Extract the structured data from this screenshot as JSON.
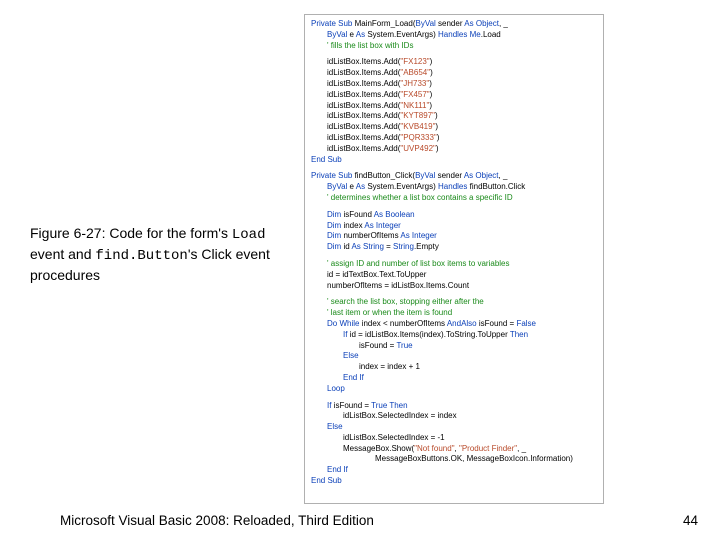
{
  "caption": {
    "prefix": "Figure 6-27: Code for the form's ",
    "mono1": "Load",
    "mid1": " event and ",
    "mono2": "find.Button",
    "mid2": "'s Click event procedures"
  },
  "footer": {
    "left": "Microsoft Visual Basic 2008: Reloaded, Third Edition",
    "page": "44"
  },
  "code": {
    "l01a": "Private Sub",
    "l01b": " MainForm_Load(",
    "l01c": "ByVal",
    "l01d": " sender ",
    "l01e": "As Object",
    "l01f": ", _",
    "l02a": "ByVal",
    "l02b": " e ",
    "l02c": "As",
    "l02d": " System.EventArgs) ",
    "l02e": "Handles Me",
    "l02f": ".Load",
    "l03": "' fills the list box with IDs",
    "l04": "idListBox.Items.Add(",
    "s1": "\"FX123\"",
    "s2": "\"AB654\"",
    "s3": "\"JH733\"",
    "s4": "\"FX457\"",
    "s5": "\"NK111\"",
    "s6": "\"KYT897\"",
    "s7": "\"KVB419\"",
    "s8": "\"PQR333\"",
    "s9": "\"UVP492\"",
    "rp": ")",
    "l13": "End Sub",
    "l15a": "Private Sub",
    "l15b": " findButton_Click(",
    "l15c": "ByVal",
    "l15d": " sender ",
    "l15e": "As Object",
    "l15f": ", _",
    "l16a": "ByVal",
    "l16b": " e ",
    "l16c": "As",
    "l16d": " System.EventArgs) ",
    "l16e": "Handles",
    "l16f": " findButton.Click",
    "l17": "' determines whether a list box contains a specific ID",
    "l18a": "Dim",
    "l18b": " isFound ",
    "l18c": "As Boolean",
    "l19a": "Dim",
    "l19b": " index ",
    "l19c": "As Integer",
    "l20a": "Dim",
    "l20b": " numberOfItems ",
    "l20c": "As Integer",
    "l21a": "Dim",
    "l21b": " id ",
    "l21c": "As String",
    "l21d": " = ",
    "l21e": "String",
    "l21f": ".Empty",
    "l22": "' assign ID and number of list box items to variables",
    "l23": "id = idTextBox.Text.ToUpper",
    "l24": "numberOfItems = idListBox.Items.Count",
    "l25": "' search the list box, stopping either after the",
    "l26": "' last item or when the item is found",
    "l27a": "Do While",
    "l27b": " index < numberOfItems ",
    "l27c": "AndAlso",
    "l27d": " isFound = ",
    "l27e": "False",
    "l28a": "If",
    "l28b": " id = idListBox.Items(index).ToString.ToUpper ",
    "l28c": "Then",
    "l29a": "isFound = ",
    "l29b": "True",
    "l30": "Else",
    "l31": "index = index + 1",
    "l32": "End If",
    "l33": "Loop",
    "l34a": "If",
    "l34b": " isFound = ",
    "l34c": "True Then",
    "l35": "idListBox.SelectedIndex = index",
    "l36": "Else",
    "l37": "idListBox.SelectedIndex = -1",
    "l38a": "MessageBox.Show(",
    "l38b": "\"Not found\"",
    "l38c": ", ",
    "l38d": "\"Product Finder\"",
    "l38e": ", _",
    "l39": "MessageBoxButtons.OK, MessageBoxIcon.Information)",
    "l40": "End If",
    "l41": "End Sub"
  }
}
